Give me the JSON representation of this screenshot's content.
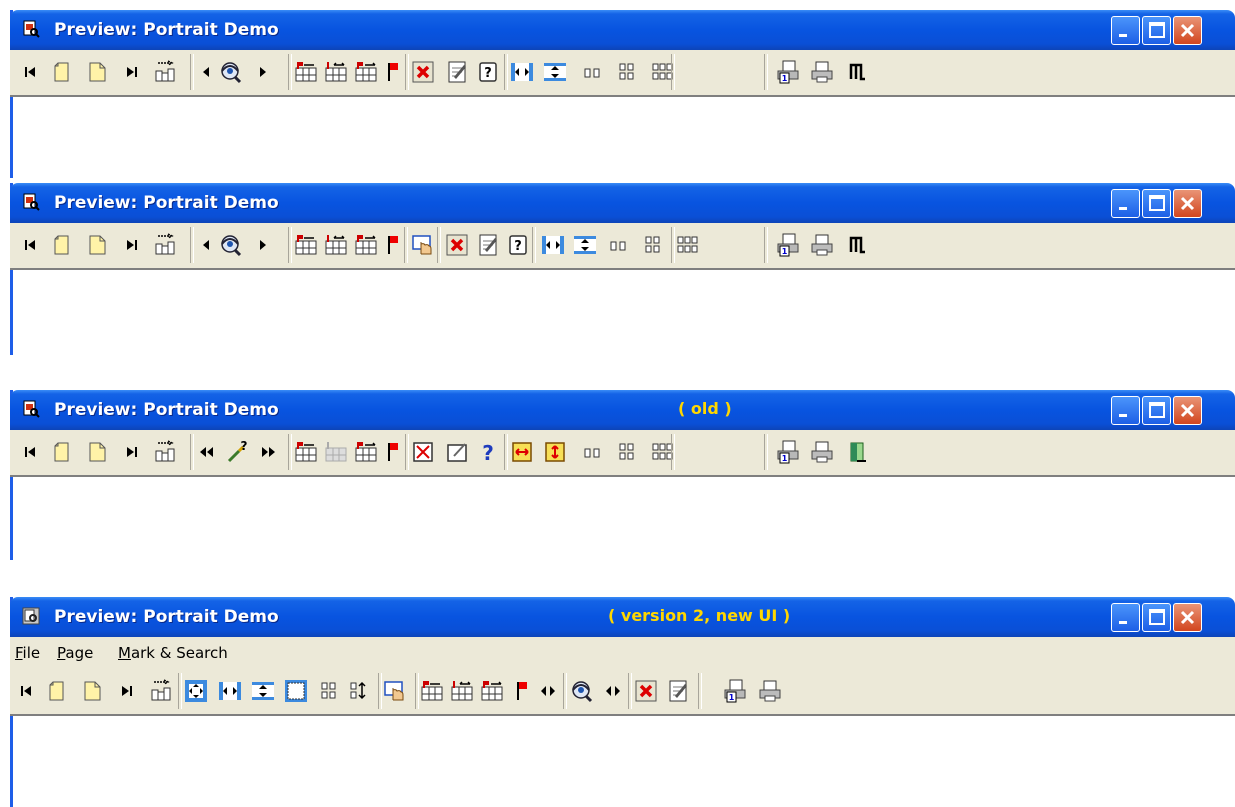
{
  "windows": [
    {
      "title": "Preview: Portrait Demo",
      "note": ""
    },
    {
      "title": "Preview: Portrait Demo",
      "note": ""
    },
    {
      "title": "Preview: Portrait Demo",
      "note": "( old )"
    },
    {
      "title": "Preview: Portrait Demo",
      "note": "( version 2, new UI )",
      "menu": [
        {
          "accel": "F",
          "rest": "ile"
        },
        {
          "accel": "P",
          "rest": "age"
        },
        {
          "accel": "M",
          "rest": "ark & Search"
        }
      ]
    }
  ],
  "toolbar_icons": {
    "v1": [
      "first-page",
      "page-portrait",
      "page-blank",
      "last-page",
      "goto-page",
      "sep",
      "prev-search",
      "eye-search",
      "next-search",
      "sep",
      "mark-1",
      "mark-2",
      "mark-3",
      "flag",
      "sep",
      "sep",
      "delete",
      "edit",
      "help",
      "sep",
      "fit-width",
      "fit-height",
      "two-pages",
      "four-pages",
      "six-pages",
      "sep",
      "print-page",
      "print",
      "exit"
    ],
    "v2": [
      "first-page",
      "page-portrait",
      "page-blank",
      "last-page",
      "goto-page",
      "sep",
      "prev-search",
      "eye-search",
      "next-search",
      "sep",
      "mark-1",
      "mark-2",
      "mark-3",
      "flag",
      "sep",
      "hand-tool",
      "sep",
      "delete",
      "edit",
      "help",
      "sep",
      "fit-width",
      "fit-height",
      "two-pages",
      "four-pages",
      "six-pages",
      "sep",
      "print-page",
      "print",
      "exit"
    ],
    "old": [
      "first-page",
      "page-portrait",
      "page-blank",
      "last-page",
      "goto-page",
      "sep",
      "rewind",
      "search-pen",
      "forward",
      "sep",
      "mark-1",
      "mark-disabled",
      "mark-3",
      "flag",
      "sep",
      "delete-old",
      "edit-old",
      "question",
      "sep",
      "fit-width-old",
      "fit-height-old",
      "two-pages",
      "four-pages",
      "six-pages",
      "sep",
      "print-page",
      "print",
      "exit-door"
    ],
    "v3": [
      "first-page",
      "page-portrait",
      "page-blank",
      "last-page",
      "goto-page",
      "sep",
      "fit-all",
      "fit-width",
      "fit-height",
      "fit-page",
      "four-pages",
      "sort-pages",
      "sep",
      "hand-tool",
      "sep",
      "mark-1",
      "mark-2",
      "mark-3",
      "flag",
      "prev-next",
      "sep",
      "eye-search",
      "prev-next",
      "sep",
      "delete",
      "edit",
      "sep",
      "print-page",
      "print"
    ]
  },
  "colors": {
    "titlebar": "#0a54e0",
    "note": "#ffd700",
    "toolbar": "#ece9d8",
    "accent": "#1e5ee8"
  }
}
